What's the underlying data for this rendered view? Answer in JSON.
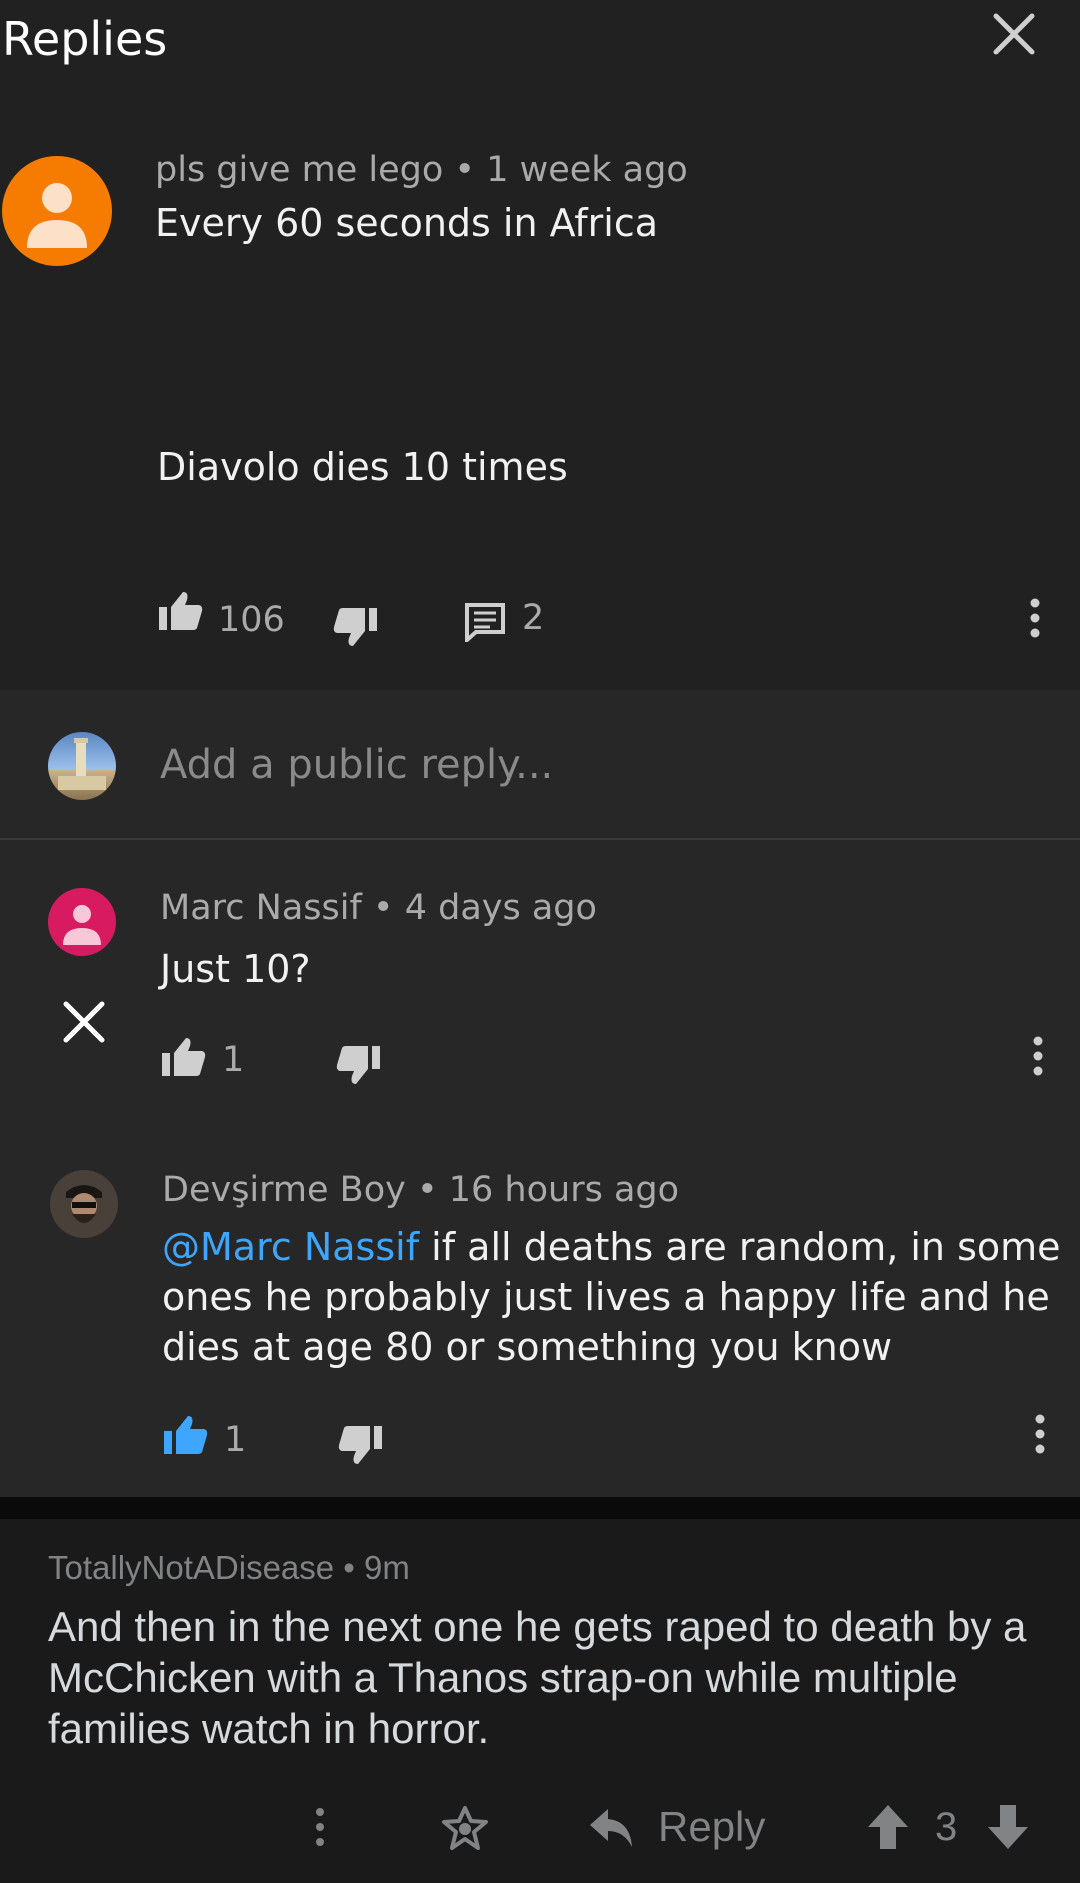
{
  "header": {
    "title": "Replies"
  },
  "main_comment": {
    "author": "pls give me lego",
    "time": "1 week ago",
    "line1": "Every 60 seconds in Africa",
    "line2": "Diavolo dies 10 times",
    "likes": "106",
    "replies": "2"
  },
  "reply_box": {
    "placeholder": "Add a public reply..."
  },
  "replies": [
    {
      "author": "Marc Nassif",
      "time": "4 days ago",
      "text": "Just 10?",
      "likes": "1"
    },
    {
      "author": "Devşirme Boy",
      "time": "16 hours ago",
      "mention": "@Marc Nassif",
      "text": " if all deaths are random, in some ones he probably just lives a happy life and he dies at age 80 or something you know",
      "likes": "1"
    }
  ],
  "reddit_comment": {
    "author": "TotallyNotADisease",
    "time": "9m",
    "text": "And then in the next one he gets raped to death by a McChicken with a Thanos strap-on while multiple families watch in horror.",
    "reply_label": "Reply",
    "score": "3"
  },
  "colors": {
    "main_avatar": "#f57c00",
    "marc_avatar": "#d81b60",
    "liked_blue": "#3ea6ff",
    "reddit_bg": "#1a1a1b"
  }
}
